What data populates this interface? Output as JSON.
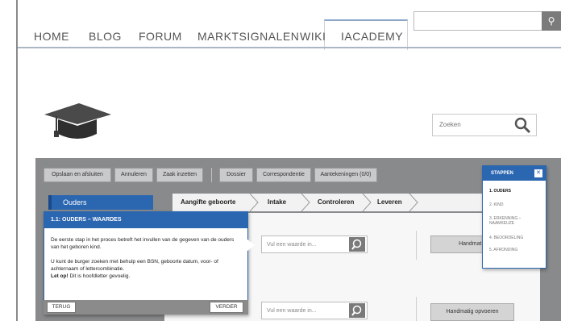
{
  "nav": {
    "items": [
      "HOME",
      "BLOG",
      "FORUM",
      "MARKTSIGNALEN",
      "WIKI",
      "IACADEMY"
    ],
    "active_index": 5
  },
  "search": {
    "placeholder": "Zoeken"
  },
  "toolbar": {
    "buttons": [
      "Opslaan en afsluiten",
      "Annuleren",
      "Zaak inzetten",
      "Dossier",
      "Correspondentie",
      "Aantekeningen (0/0)"
    ]
  },
  "sidebar": {
    "active_item": "Ouders"
  },
  "breadcrumb": {
    "steps": [
      "Aangifte geboorte",
      "Intake",
      "Controleren",
      "Leveren"
    ]
  },
  "form": {
    "field_placeholder": "Vul een waarde in...",
    "manual_button_short": "Handmatig",
    "manual_button": "Handmatig opvoeren"
  },
  "tooltip": {
    "title": "1.1: OUDERS – WAARDES",
    "para1": "De eerste stap in het proces betreft het invullen van de gegeven van de ouders van het geboren kind.",
    "para2": "U kunt de burger zoeken met behulp een BSN, geboorte datum, voor- of achternaam of lettercombinatie.",
    "note_bold": "Let op!",
    "note_rest": "Dit is hoofdletter gevoelig.",
    "back": "TERUG",
    "next": "VERDER"
  },
  "stappen": {
    "title": "STAPPEN",
    "steps": [
      "1. OUDERS",
      "2. KIND",
      "3. ERKENNING – NAAMKEUZE",
      "4. BEOORDELING",
      "5. AFRONDING"
    ],
    "active_index": 0
  },
  "colors": {
    "accent": "#2b66b1",
    "panel": "#888a8c"
  }
}
